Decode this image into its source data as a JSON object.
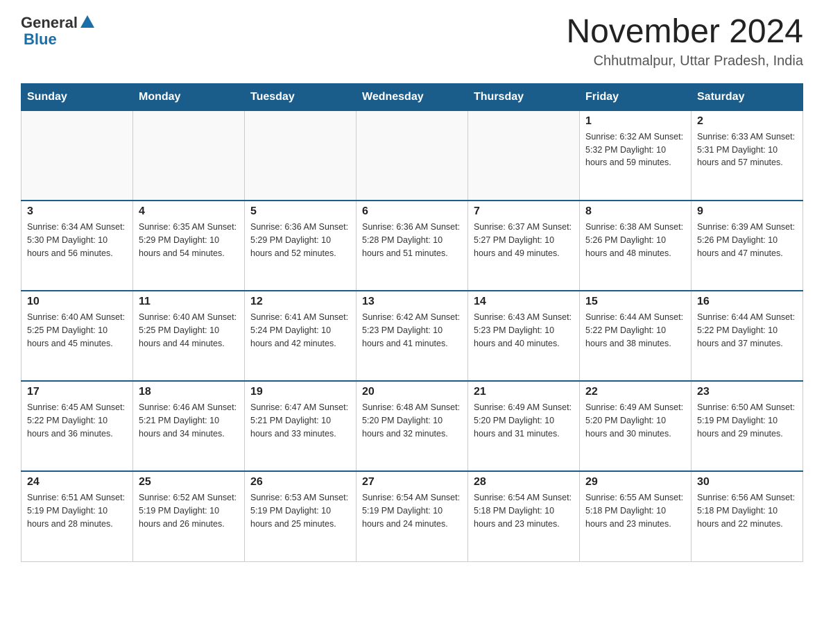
{
  "header": {
    "logo_general": "General",
    "logo_blue": "Blue",
    "month_title": "November 2024",
    "location": "Chhutmalpur, Uttar Pradesh, India"
  },
  "days_of_week": [
    "Sunday",
    "Monday",
    "Tuesday",
    "Wednesday",
    "Thursday",
    "Friday",
    "Saturday"
  ],
  "weeks": [
    [
      {
        "day": "",
        "info": ""
      },
      {
        "day": "",
        "info": ""
      },
      {
        "day": "",
        "info": ""
      },
      {
        "day": "",
        "info": ""
      },
      {
        "day": "",
        "info": ""
      },
      {
        "day": "1",
        "info": "Sunrise: 6:32 AM\nSunset: 5:32 PM\nDaylight: 10 hours and 59 minutes."
      },
      {
        "day": "2",
        "info": "Sunrise: 6:33 AM\nSunset: 5:31 PM\nDaylight: 10 hours and 57 minutes."
      }
    ],
    [
      {
        "day": "3",
        "info": "Sunrise: 6:34 AM\nSunset: 5:30 PM\nDaylight: 10 hours and 56 minutes."
      },
      {
        "day": "4",
        "info": "Sunrise: 6:35 AM\nSunset: 5:29 PM\nDaylight: 10 hours and 54 minutes."
      },
      {
        "day": "5",
        "info": "Sunrise: 6:36 AM\nSunset: 5:29 PM\nDaylight: 10 hours and 52 minutes."
      },
      {
        "day": "6",
        "info": "Sunrise: 6:36 AM\nSunset: 5:28 PM\nDaylight: 10 hours and 51 minutes."
      },
      {
        "day": "7",
        "info": "Sunrise: 6:37 AM\nSunset: 5:27 PM\nDaylight: 10 hours and 49 minutes."
      },
      {
        "day": "8",
        "info": "Sunrise: 6:38 AM\nSunset: 5:26 PM\nDaylight: 10 hours and 48 minutes."
      },
      {
        "day": "9",
        "info": "Sunrise: 6:39 AM\nSunset: 5:26 PM\nDaylight: 10 hours and 47 minutes."
      }
    ],
    [
      {
        "day": "10",
        "info": "Sunrise: 6:40 AM\nSunset: 5:25 PM\nDaylight: 10 hours and 45 minutes."
      },
      {
        "day": "11",
        "info": "Sunrise: 6:40 AM\nSunset: 5:25 PM\nDaylight: 10 hours and 44 minutes."
      },
      {
        "day": "12",
        "info": "Sunrise: 6:41 AM\nSunset: 5:24 PM\nDaylight: 10 hours and 42 minutes."
      },
      {
        "day": "13",
        "info": "Sunrise: 6:42 AM\nSunset: 5:23 PM\nDaylight: 10 hours and 41 minutes."
      },
      {
        "day": "14",
        "info": "Sunrise: 6:43 AM\nSunset: 5:23 PM\nDaylight: 10 hours and 40 minutes."
      },
      {
        "day": "15",
        "info": "Sunrise: 6:44 AM\nSunset: 5:22 PM\nDaylight: 10 hours and 38 minutes."
      },
      {
        "day": "16",
        "info": "Sunrise: 6:44 AM\nSunset: 5:22 PM\nDaylight: 10 hours and 37 minutes."
      }
    ],
    [
      {
        "day": "17",
        "info": "Sunrise: 6:45 AM\nSunset: 5:22 PM\nDaylight: 10 hours and 36 minutes."
      },
      {
        "day": "18",
        "info": "Sunrise: 6:46 AM\nSunset: 5:21 PM\nDaylight: 10 hours and 34 minutes."
      },
      {
        "day": "19",
        "info": "Sunrise: 6:47 AM\nSunset: 5:21 PM\nDaylight: 10 hours and 33 minutes."
      },
      {
        "day": "20",
        "info": "Sunrise: 6:48 AM\nSunset: 5:20 PM\nDaylight: 10 hours and 32 minutes."
      },
      {
        "day": "21",
        "info": "Sunrise: 6:49 AM\nSunset: 5:20 PM\nDaylight: 10 hours and 31 minutes."
      },
      {
        "day": "22",
        "info": "Sunrise: 6:49 AM\nSunset: 5:20 PM\nDaylight: 10 hours and 30 minutes."
      },
      {
        "day": "23",
        "info": "Sunrise: 6:50 AM\nSunset: 5:19 PM\nDaylight: 10 hours and 29 minutes."
      }
    ],
    [
      {
        "day": "24",
        "info": "Sunrise: 6:51 AM\nSunset: 5:19 PM\nDaylight: 10 hours and 28 minutes."
      },
      {
        "day": "25",
        "info": "Sunrise: 6:52 AM\nSunset: 5:19 PM\nDaylight: 10 hours and 26 minutes."
      },
      {
        "day": "26",
        "info": "Sunrise: 6:53 AM\nSunset: 5:19 PM\nDaylight: 10 hours and 25 minutes."
      },
      {
        "day": "27",
        "info": "Sunrise: 6:54 AM\nSunset: 5:19 PM\nDaylight: 10 hours and 24 minutes."
      },
      {
        "day": "28",
        "info": "Sunrise: 6:54 AM\nSunset: 5:18 PM\nDaylight: 10 hours and 23 minutes."
      },
      {
        "day": "29",
        "info": "Sunrise: 6:55 AM\nSunset: 5:18 PM\nDaylight: 10 hours and 23 minutes."
      },
      {
        "day": "30",
        "info": "Sunrise: 6:56 AM\nSunset: 5:18 PM\nDaylight: 10 hours and 22 minutes."
      }
    ]
  ]
}
